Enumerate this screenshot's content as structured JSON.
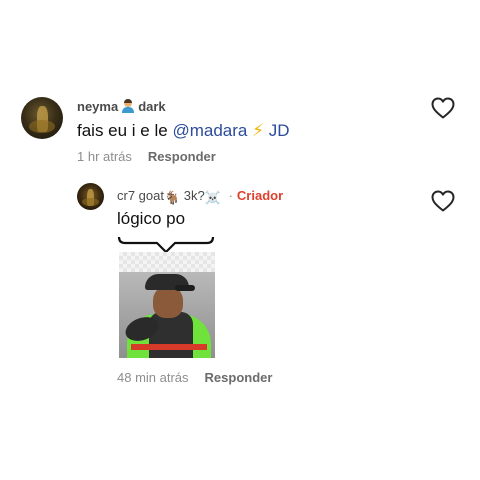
{
  "comment": {
    "username": "neyma",
    "username_tail": "dark",
    "text_prefix": "fais eu i e le ",
    "mention": "@madara",
    "bolt": "⚡",
    "tag": "JD",
    "time": "1 hr atrás",
    "reply_label": "Responder"
  },
  "reply": {
    "username": "cr7 goat",
    "goat_emoji": "🐐",
    "count_text": "3k?",
    "skull_emoji": "☠️",
    "separator": "·",
    "creator_label": "Criador",
    "text": "lógico po",
    "time": "48 min atrás",
    "reply_label": "Responder"
  },
  "icons": {
    "like": "heart-outline-icon",
    "shrug": "person-shrugging-icon"
  },
  "colors": {
    "mention": "#2c4c9c",
    "creator": "#e0402e",
    "meta": "#8e8e8e"
  }
}
